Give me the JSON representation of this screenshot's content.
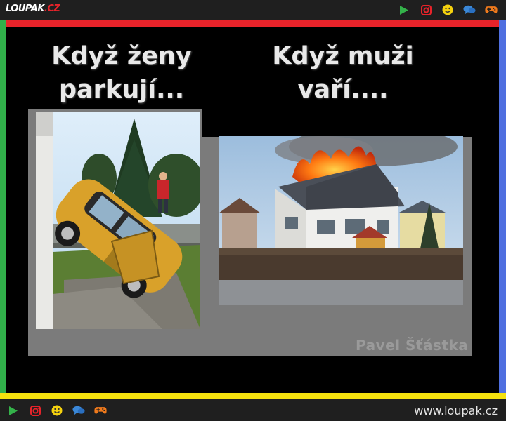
{
  "site": {
    "logo_main": "LOUPAK",
    "logo_tld": ".CZ",
    "url": "www.loupak.cz"
  },
  "toolbar_icons": [
    "play-icon",
    "instagram-icon",
    "smiley-icon",
    "chat-icon",
    "gamepad-icon"
  ],
  "colors": {
    "bar": "#1f1f1f",
    "red": "#e8232a",
    "green": "#31b04a",
    "blue": "#4f6fe0",
    "yellow": "#f5e10e"
  },
  "meme": {
    "left_caption_line1": "Když ženy",
    "left_caption_line2": "parkují...",
    "right_caption_line1": "Když muži",
    "right_caption_line2": "vaří....",
    "signature": "Pavel Šťástka"
  }
}
